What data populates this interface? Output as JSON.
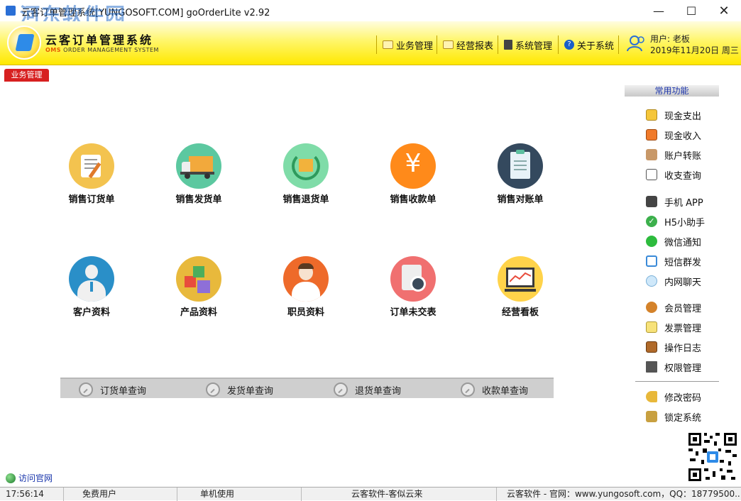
{
  "window": {
    "title": "云客订单管理系统[YUNGOSOFT.COM]  goOrderLite v2.92",
    "watermark": "河东软件园"
  },
  "brand": {
    "cn": "云客订单管理系统",
    "en_prefix": "OMS",
    "en_rest": " ORDER MANAGEMENT SYSTEM"
  },
  "topnav": [
    {
      "label": "业务管理"
    },
    {
      "label": "经营报表"
    },
    {
      "label": "系统管理"
    },
    {
      "label": "关于系统"
    }
  ],
  "user": {
    "name": "用户: 老板",
    "date": "2019年11月20日 周三"
  },
  "tab": {
    "label": "业务管理"
  },
  "tiles": [
    {
      "label": "销售订货单",
      "icon": "order-form-icon",
      "color": "#f3c34f"
    },
    {
      "label": "销售发货单",
      "icon": "delivery-truck-icon",
      "color": "#5cc8a0"
    },
    {
      "label": "销售退货单",
      "icon": "return-cycle-icon",
      "color": "#7fdca8"
    },
    {
      "label": "销售收款单",
      "icon": "yuan-icon",
      "color": "#ff8a1a"
    },
    {
      "label": "销售对账单",
      "icon": "clipboard-icon",
      "color": "#34495e"
    },
    {
      "label": "客户资料",
      "icon": "customer-icon",
      "color": "#2a8fc8"
    },
    {
      "label": "产品资料",
      "icon": "product-blocks-icon",
      "color": "#e8b93c"
    },
    {
      "label": "职员资料",
      "icon": "staff-icon",
      "color": "#ee6a2a"
    },
    {
      "label": "订单未交表",
      "icon": "stopwatch-icon",
      "color": "#f07070"
    },
    {
      "label": "经营看板",
      "icon": "dashboard-monitor-icon",
      "color": "#ffd34a"
    }
  ],
  "queries": [
    {
      "label": "订货单查询"
    },
    {
      "label": "发货单查询"
    },
    {
      "label": "退货单查询"
    },
    {
      "label": "收款单查询"
    }
  ],
  "sidebar": {
    "title": "常用功能",
    "items": [
      {
        "label": "现金支出",
        "icon": "cash-out-icon"
      },
      {
        "label": "现金收入",
        "icon": "cash-in-icon"
      },
      {
        "label": "账户转账",
        "icon": "transfer-sign-icon"
      },
      {
        "label": "收支查询",
        "icon": "query-icon"
      },
      {
        "label": "手机 APP",
        "icon": "phone-calculator-icon"
      },
      {
        "label": "H5小助手",
        "icon": "check-circle-icon"
      },
      {
        "label": "微信通知",
        "icon": "wechat-icon"
      },
      {
        "label": "短信群发",
        "icon": "sms-icon"
      },
      {
        "label": "内网聊天",
        "icon": "chat-bubble-icon"
      },
      {
        "label": "会员管理",
        "icon": "member-badge-icon"
      },
      {
        "label": "发票管理",
        "icon": "invoice-icon"
      },
      {
        "label": "操作日志",
        "icon": "log-book-icon"
      },
      {
        "label": "权限管理",
        "icon": "monitor-icon"
      },
      {
        "label": "修改密码",
        "icon": "key-icon"
      },
      {
        "label": "锁定系统",
        "icon": "lock-icon"
      }
    ]
  },
  "visit": {
    "label": "访问官网"
  },
  "status": {
    "time": "17:56:14",
    "user_type": "免费用户",
    "mode": "单机使用",
    "slogan": "云客软件-客似云来",
    "contact": "云客软件 - 官网：www.yungosoft.com，QQ：18779500..."
  }
}
